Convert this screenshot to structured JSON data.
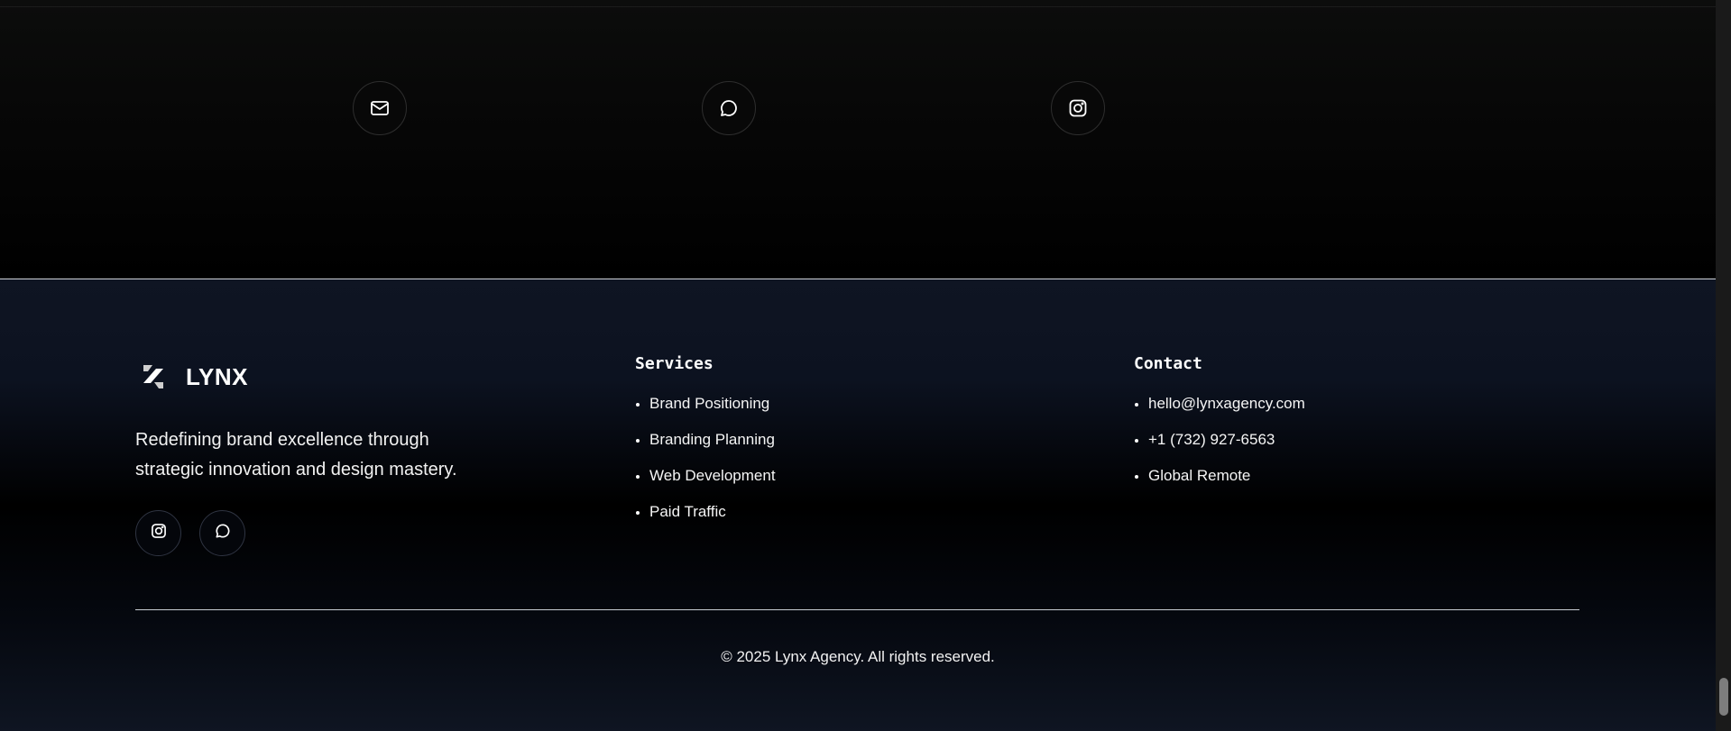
{
  "contact_icons": [
    {
      "icon": "mail-icon",
      "label": "Email"
    },
    {
      "icon": "chat-icon",
      "label": "Chat"
    },
    {
      "icon": "instagram-icon",
      "label": "Instagram"
    }
  ],
  "footer": {
    "brand": {
      "logo": "lynx-logo-icon",
      "name": "LYNX"
    },
    "tagline": "Redefining brand excellence through strategic innovation and design mastery.",
    "socials": [
      {
        "icon": "instagram-icon"
      },
      {
        "icon": "chat-icon"
      }
    ],
    "services": {
      "title": "Services",
      "items": [
        "Brand Positioning",
        "Branding Planning",
        "Web Development",
        "Paid Traffic"
      ]
    },
    "contact": {
      "title": "Contact",
      "items": [
        "hello@lynxagency.com",
        "+1 (732) 927-6563",
        "Global Remote"
      ]
    },
    "copyright": "© 2025 Lynx Agency. All rights reserved."
  },
  "colors": {
    "background": "#000000",
    "footer_gradient_top": "#0f1523",
    "text": "#ffffff",
    "divider": "#c7ccd4"
  }
}
